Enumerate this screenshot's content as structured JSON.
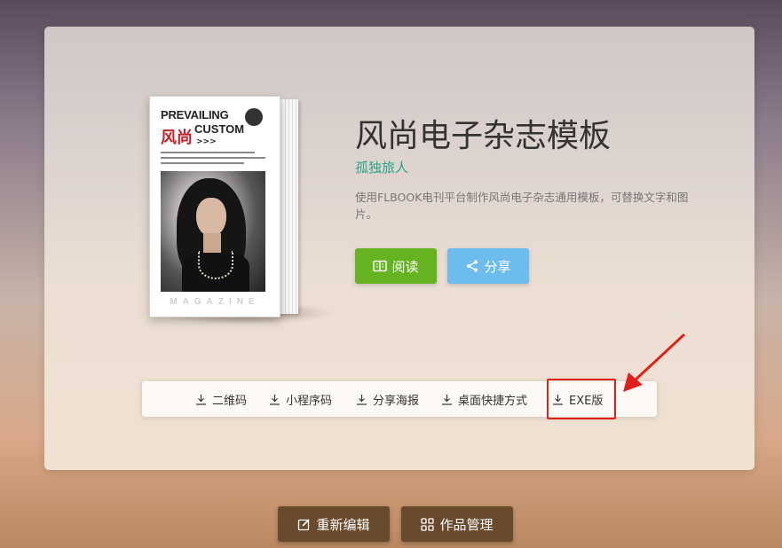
{
  "book": {
    "cover_title_line1": "PREVAILING",
    "cover_title_line2": "CUSTOM",
    "cover_cn": "风尚",
    "cover_arrows": ">>>",
    "cover_footer": "MAGAZINE"
  },
  "info": {
    "title": "风尚电子杂志模板",
    "author": "孤独旅人",
    "description": "使用FLBOOK电刊平台制作风尚电子杂志通用模板，可替换文字和图片。"
  },
  "actions": {
    "read_label": "阅读",
    "share_label": "分享"
  },
  "downloads": [
    {
      "label": "二维码",
      "icon": "download-icon"
    },
    {
      "label": "小程序码",
      "icon": "download-icon"
    },
    {
      "label": "分享海报",
      "icon": "download-icon"
    },
    {
      "label": "桌面快捷方式",
      "icon": "download-icon"
    },
    {
      "label": "EXE版",
      "icon": "download-icon"
    }
  ],
  "bottom": {
    "edit_label": "重新编辑",
    "manage_label": "作品管理"
  },
  "colors": {
    "read_button": "#66b321",
    "share_button": "#6cbcee",
    "author": "#2aa58a",
    "highlight": "#e0201a",
    "bottom_button": "#6a4a2c"
  }
}
